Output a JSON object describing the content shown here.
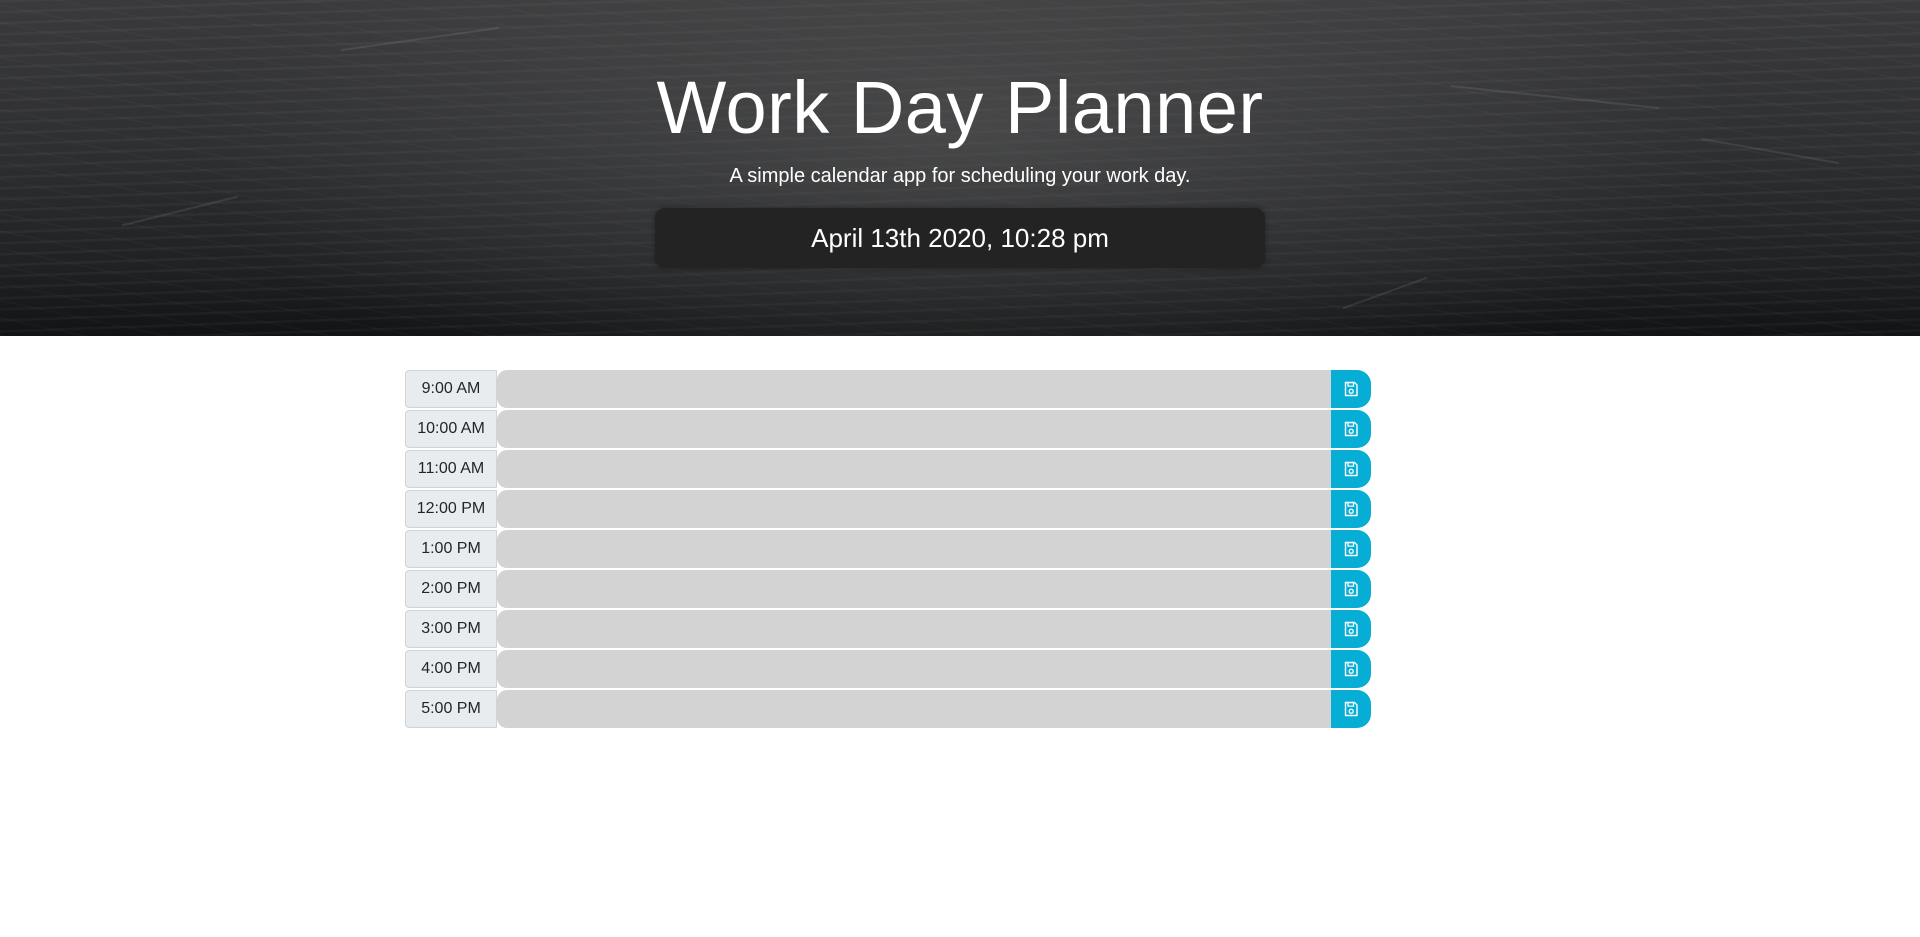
{
  "header": {
    "title": "Work Day Planner",
    "subtitle": "A simple calendar app for scheduling your work day.",
    "current_day": "April 13th 2020, 10:28 pm"
  },
  "colors": {
    "past_block": "#d3d3d3",
    "save_button": "#06aed5",
    "hour_label_bg": "#e9ecef"
  },
  "save_icon": "floppy-disk-icon",
  "time_blocks": [
    {
      "hour": "9:00 AM",
      "text": ""
    },
    {
      "hour": "10:00 AM",
      "text": ""
    },
    {
      "hour": "11:00 AM",
      "text": ""
    },
    {
      "hour": "12:00 PM",
      "text": ""
    },
    {
      "hour": "1:00 PM",
      "text": ""
    },
    {
      "hour": "2:00 PM",
      "text": ""
    },
    {
      "hour": "3:00 PM",
      "text": ""
    },
    {
      "hour": "4:00 PM",
      "text": ""
    },
    {
      "hour": "5:00 PM",
      "text": ""
    }
  ]
}
